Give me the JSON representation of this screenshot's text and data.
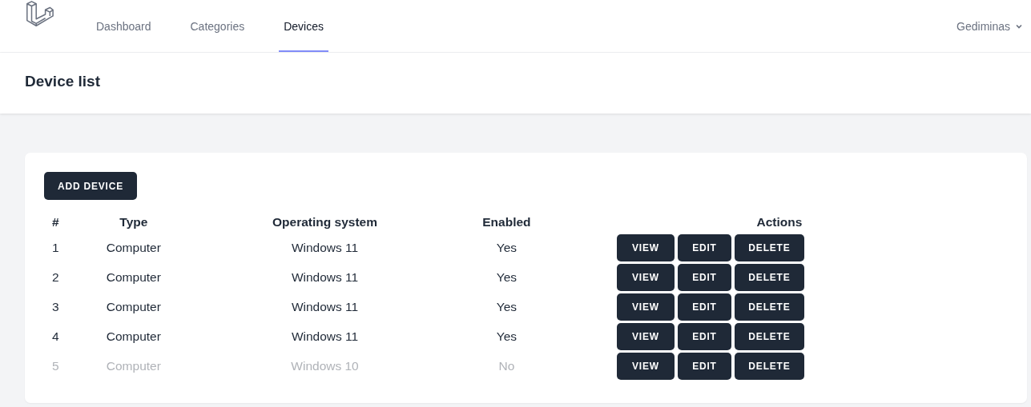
{
  "nav": {
    "links": [
      {
        "label": "Dashboard",
        "selected": false
      },
      {
        "label": "Categories",
        "selected": false
      },
      {
        "label": "Devices",
        "selected": true
      }
    ],
    "user": "Gediminas"
  },
  "header": {
    "title": "Device list"
  },
  "add_button": "ADD DEVICE",
  "table": {
    "columns": [
      "#",
      "Type",
      "Operating system",
      "Enabled",
      "Actions"
    ],
    "rows": [
      {
        "number": "1",
        "type": "Computer",
        "os": "Windows 11",
        "enabled_text": "Yes",
        "enabled": true,
        "actions": [
          "VIEW",
          "EDIT",
          "DELETE"
        ]
      },
      {
        "number": "2",
        "type": "Computer",
        "os": "Windows 11",
        "enabled_text": "Yes",
        "enabled": true,
        "actions": [
          "VIEW",
          "EDIT",
          "DELETE"
        ]
      },
      {
        "number": "3",
        "type": "Computer",
        "os": "Windows 11",
        "enabled_text": "Yes",
        "enabled": true,
        "actions": [
          "VIEW",
          "EDIT",
          "DELETE"
        ]
      },
      {
        "number": "4",
        "type": "Computer",
        "os": "Windows 11",
        "enabled_text": "Yes",
        "enabled": true,
        "actions": [
          "VIEW",
          "EDIT",
          "DELETE"
        ]
      },
      {
        "number": "5",
        "type": "Computer",
        "os": "Windows 10",
        "enabled_text": "No",
        "enabled": false,
        "actions": [
          "VIEW",
          "EDIT",
          "DELETE"
        ]
      }
    ]
  }
}
